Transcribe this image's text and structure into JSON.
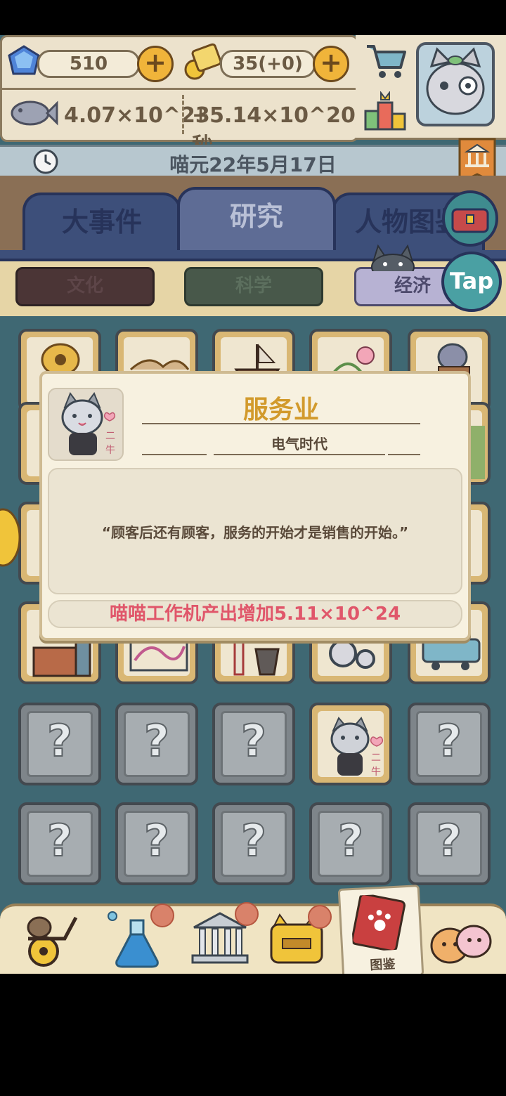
{
  "header": {
    "gems": "510",
    "tickets": "35(+0)",
    "fish_total": "4.07×10^23",
    "fish_rate": "+5.14×10^20/秒"
  },
  "calendar": {
    "date": "喵元22年5月17日"
  },
  "tabs": [
    {
      "label": "大事件"
    },
    {
      "label": "研究"
    },
    {
      "label": "人物图鉴"
    }
  ],
  "subtabs": [
    {
      "label": "文化"
    },
    {
      "label": "科学"
    },
    {
      "label": "经济"
    }
  ],
  "tap_button": {
    "label": "Tap"
  },
  "modal": {
    "title": "服务业",
    "era": "电气时代",
    "quote": "“顾客后还有顾客，服务的开始才是销售的开始。”",
    "effect": "喵喵工作机产出增加5.11×10^24",
    "portrait_tag": "二牛"
  },
  "grid": {
    "question_mark": "?",
    "unlocked_tag": "二牛"
  },
  "bottom_nav": {
    "active_label": "图鉴"
  },
  "colors": {
    "title_gold": "#d29a2c",
    "effect_red": "#e0566a",
    "game_bg": "#3f6873",
    "tab_active": "#5e6c95"
  }
}
